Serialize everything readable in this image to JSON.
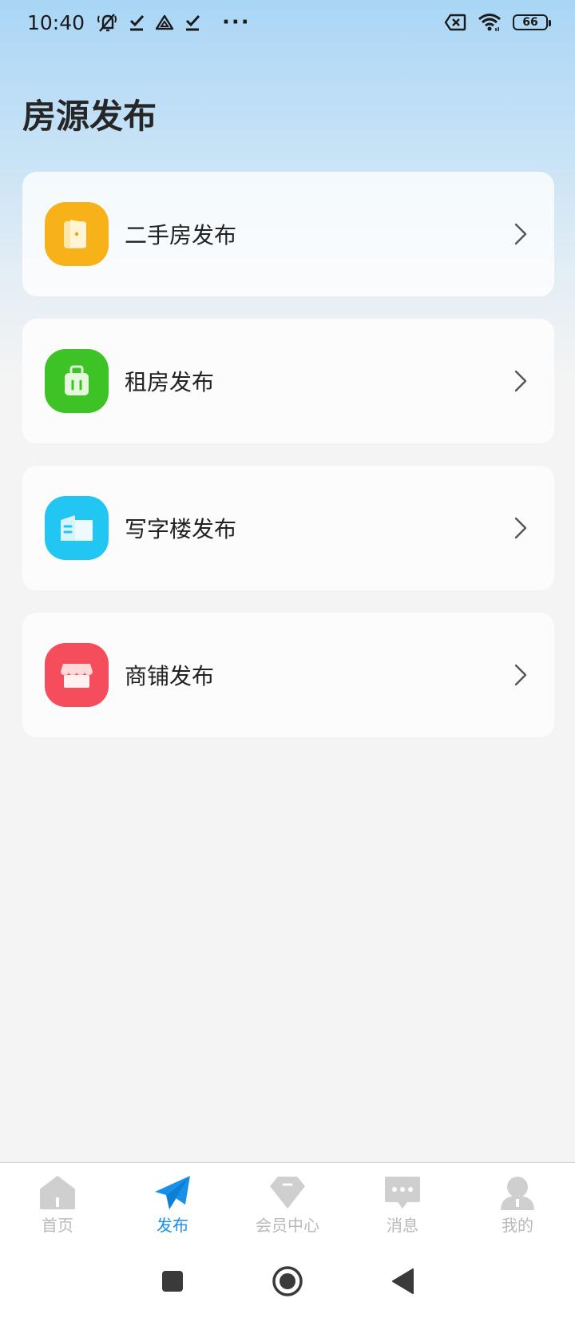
{
  "status_bar": {
    "time": "10:40",
    "left_icons": [
      "mute-icon",
      "download-done-icon",
      "drive-icon",
      "download-done-icon"
    ],
    "more": "···",
    "battery": "66",
    "right_icons": [
      "sim-blocked-icon",
      "wifi-icon",
      "battery-icon"
    ]
  },
  "header": {
    "title": "房源发布"
  },
  "menu": {
    "items": [
      {
        "label": "二手房发布",
        "icon": "door-icon",
        "color": "#f7b219"
      },
      {
        "label": "租房发布",
        "icon": "luggage-icon",
        "color": "#3dc326"
      },
      {
        "label": "写字楼发布",
        "icon": "building-icon",
        "color": "#21c6f2"
      },
      {
        "label": "商铺发布",
        "icon": "storefront-icon",
        "color": "#f54d5c"
      }
    ]
  },
  "tabbar": {
    "active_color": "#1690e8",
    "inactive_color": "#b9b9b9",
    "items": [
      {
        "label": "首页",
        "icon": "home-icon",
        "active": false
      },
      {
        "label": "发布",
        "icon": "paper-plane-icon",
        "active": true
      },
      {
        "label": "会员中心",
        "icon": "diamond-icon",
        "active": false
      },
      {
        "label": "消息",
        "icon": "chat-icon",
        "active": false
      },
      {
        "label": "我的",
        "icon": "user-icon",
        "active": false
      }
    ]
  },
  "system_nav": [
    "recents-icon",
    "home-circle-icon",
    "back-icon"
  ]
}
